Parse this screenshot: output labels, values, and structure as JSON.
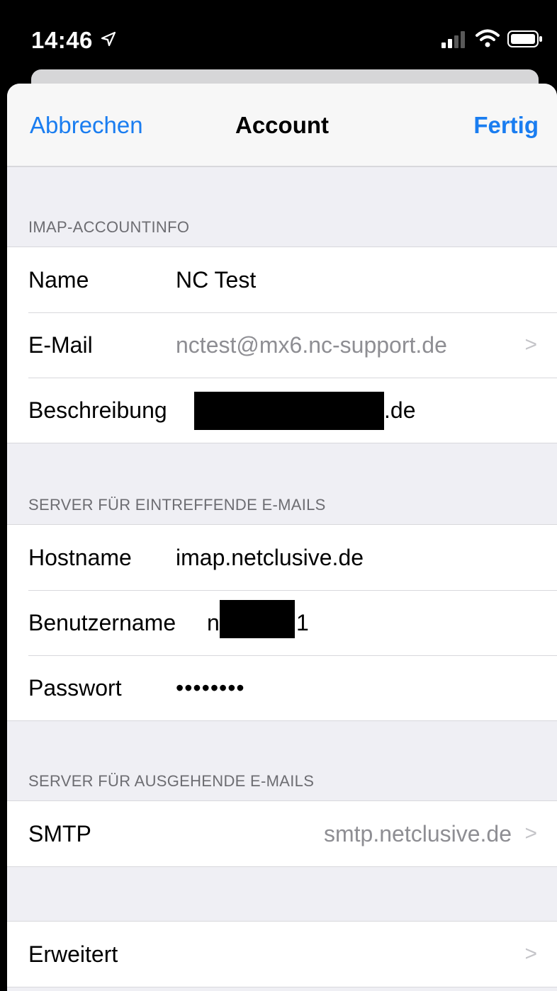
{
  "status_bar": {
    "time": "14:46",
    "icons": [
      "location-arrow-icon",
      "cellular-signal-icon",
      "wifi-icon",
      "battery-icon"
    ]
  },
  "nav": {
    "cancel_label": "Abbrechen",
    "title": "Account",
    "done_label": "Fertig"
  },
  "sections": {
    "imap": {
      "header": "IMAP-ACCOUNTINFO",
      "name": {
        "label": "Name",
        "value": "NC Test"
      },
      "email": {
        "label": "E-Mail",
        "value": "nctest@mx6.nc-support.de"
      },
      "description": {
        "label": "Beschreibung",
        "value_suffix": ".de"
      }
    },
    "incoming": {
      "header": "SERVER FÜR EINTREFFENDE E-MAILS",
      "hostname": {
        "label": "Hostname",
        "value": "imap.netclusive.de"
      },
      "username": {
        "label": "Benutzername",
        "value_prefix": "n",
        "value_suffix": "1"
      },
      "password": {
        "label": "Passwort",
        "value": "••••••••"
      }
    },
    "outgoing": {
      "header": "SERVER FÜR AUSGEHENDE E-MAILS",
      "smtp": {
        "label": "SMTP",
        "value": "smtp.netclusive.de"
      }
    },
    "advanced": {
      "label": "Erweitert"
    }
  },
  "chevron": ">",
  "colors": {
    "accent": "#1a7df0",
    "background": "#efeff4",
    "secondary_text": "#8e8e93"
  }
}
